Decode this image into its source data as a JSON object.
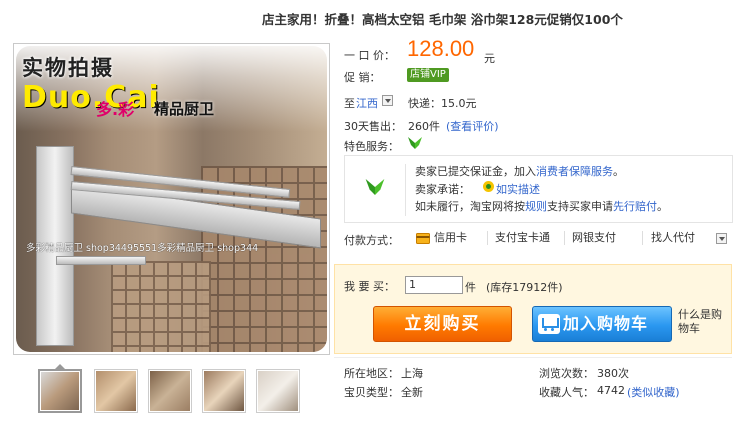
{
  "title": "店主家用！折叠！高档太空铝 毛巾架 浴巾架128元促销仅100个",
  "photo": {
    "label_line1": "实物拍摄",
    "label_brand": "Duo.Cai",
    "label_brand_cn": "多.彩",
    "label_tagline": "精品厨卫",
    "watermark": "多彩精品厨卫 shop34495551多彩精品厨卫 shop344"
  },
  "price": {
    "label": "一 口 价：",
    "value": "128.00",
    "unit": "元"
  },
  "promo": {
    "label": "促      销：",
    "badge": "店铺VIP"
  },
  "shipping": {
    "to_label": "至",
    "region": "江西",
    "method": "快递：15.0元"
  },
  "sales": {
    "label": "30天售出：",
    "count": "260件",
    "review_link": "(查看评价)"
  },
  "services": {
    "label": "特色服务：",
    "deposit_text": "卖家已提交保证金，加入",
    "deposit_link": "消费者保障服务",
    "deposit_end": "。",
    "promise_label": "卖家承诺：",
    "promise_link": "如实描述",
    "rule_pre": "如未履行，淘宝网将按",
    "rule_link1": "规则",
    "rule_mid": "支持买家申请",
    "rule_link2": "先行赔付",
    "rule_end": "。"
  },
  "payment": {
    "label": "付款方式：",
    "methods": [
      "信用卡",
      "支付宝卡通",
      "网银支付",
      "找人代付"
    ]
  },
  "purchase": {
    "qty_label": "我  要  买：",
    "qty_value": "1",
    "qty_unit": "件",
    "stock": "(库存17912件)",
    "buy_now": "立刻购买",
    "add_cart": "加入购物车",
    "what_is_cart": "什么是购物车"
  },
  "details": {
    "location_label": "所在地区：",
    "location": "上海",
    "views_label": "浏览次数：",
    "views": "380次",
    "type_label": "宝贝类型：",
    "type": "全新",
    "fav_label": "收藏人气：",
    "fav": "4742",
    "similar_link": "(类似收藏)"
  },
  "colors": {
    "price": "#ff6600",
    "link": "#3366cc",
    "buy_button": "#ff7a00",
    "cart_button": "#2a97f0",
    "vip_badge": "#4f9a21"
  }
}
